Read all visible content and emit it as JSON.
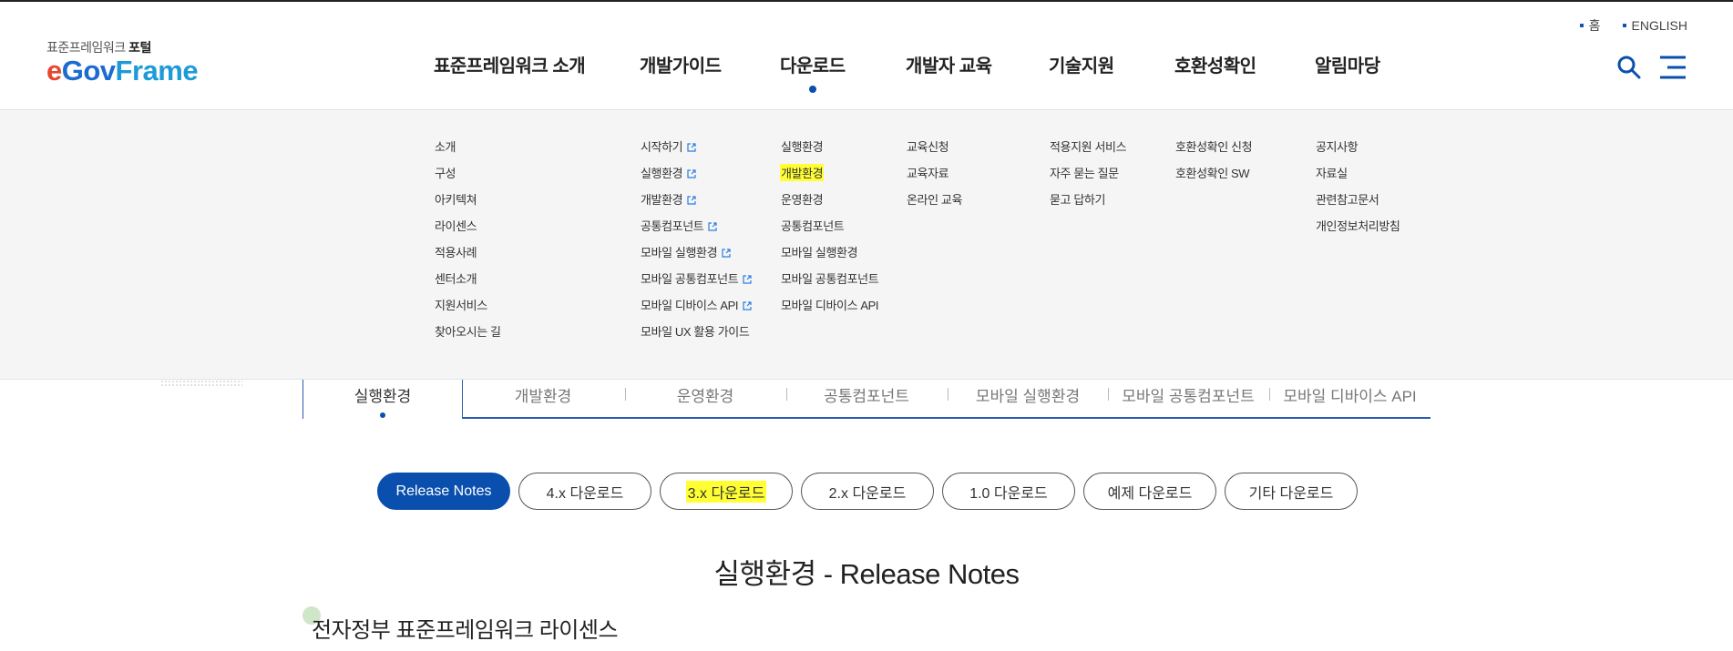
{
  "header": {
    "logo_sub_prefix": "표준프레임워크",
    "logo_sub_bold": "포털",
    "logo_e": "e",
    "logo_gov": "Gov",
    "logo_frame": "Frame",
    "util": [
      {
        "label": "홈"
      },
      {
        "label": "ENGLISH"
      }
    ],
    "gnb": [
      {
        "label": "표준프레임워크 소개"
      },
      {
        "label": "개발가이드"
      },
      {
        "label": "다운로드"
      },
      {
        "label": "개발자 교육"
      },
      {
        "label": "기술지원"
      },
      {
        "label": "호환성확인"
      },
      {
        "label": "알림마당"
      }
    ],
    "active_gnb": "다운로드"
  },
  "mega_menu": {
    "col1": [
      "소개",
      "구성",
      "아키텍쳐",
      "라이센스",
      "적용사례",
      "센터소개",
      "지원서비스",
      "찾아오시는 길"
    ],
    "col2": [
      "시작하기",
      "실행환경",
      "개발환경",
      "공통컴포넌트",
      "모바일 실행환경",
      "모바일 공통컴포넌트",
      "모바일 디바이스 API",
      "모바일 UX 활용 가이드"
    ],
    "col3": [
      "실행환경",
      "개발환경",
      "운영환경",
      "공통컴포넌트",
      "모바일 실행환경",
      "모바일 공통컴포넌트",
      "모바일 디바이스 API"
    ],
    "col3_highlighted": "개발환경",
    "col4": [
      "교육신청",
      "교육자료",
      "온라인 교육"
    ],
    "col5": [
      "적용지원 서비스",
      "자주 묻는 질문",
      "묻고 답하기"
    ],
    "col6": [
      "호환성확인 신청",
      "호환성확인 SW"
    ],
    "col7": [
      "공지사항",
      "자료실",
      "관련참고문서",
      "개인정보처리방침"
    ]
  },
  "subtabs": {
    "active": "실행환경",
    "items": [
      "개발환경",
      "운영환경",
      "공통컴포넌트",
      "모바일 실행환경",
      "모바일 공통컴포넌트",
      "모바일 디바이스 API"
    ]
  },
  "pills": [
    {
      "label": "Release Notes",
      "active": true
    },
    {
      "label": "4.x 다운로드"
    },
    {
      "label": "3.x 다운로드",
      "highlighted": true
    },
    {
      "label": "2.x 다운로드"
    },
    {
      "label": "1.0 다운로드"
    },
    {
      "label": "예제 다운로드"
    },
    {
      "label": "기타 다운로드"
    }
  ],
  "main": {
    "title": "실행환경 - Release Notes",
    "section_title": "전자정부 표준프레임워크 라이센스"
  },
  "colors": {
    "primary": "#0a4fae",
    "highlight": "#ffff33",
    "logo_e": "#e8452c",
    "logo_gov": "#1b6bd1",
    "logo_frame": "#1d9bd8"
  }
}
